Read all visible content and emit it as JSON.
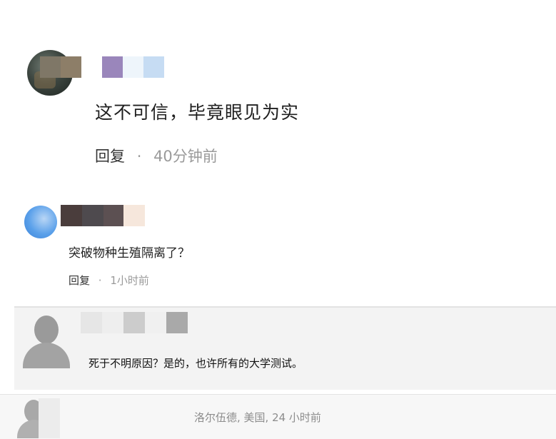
{
  "comments": [
    {
      "text": "这不可信，毕竟眼见为实",
      "reply_label": "回复",
      "separator": "·",
      "time": "40分钟前",
      "name_mosaic": [
        "#7f7767",
        "#8d7e68",
        "#ffffff",
        "#9a86bb",
        "#eef5fb",
        "#c6dcf3"
      ]
    },
    {
      "text": "突破物种生殖隔离了？",
      "reply_label": "回复",
      "separator": "·",
      "time": "1小时前",
      "name_mosaic": [
        "#4a3d3c",
        "#4e4a4e",
        "#5c5052",
        "#f6e7dc"
      ]
    },
    {
      "text": "死于不明原因？是的，也许所有的大学测试。",
      "name_mosaic": [
        "#e6e6e6",
        "#eeeeee",
        "#cccccc",
        "#f0f0f0",
        "#a9a9a9"
      ]
    },
    {
      "meta": "洛尔伍德, 美国, 24 小时前"
    }
  ]
}
